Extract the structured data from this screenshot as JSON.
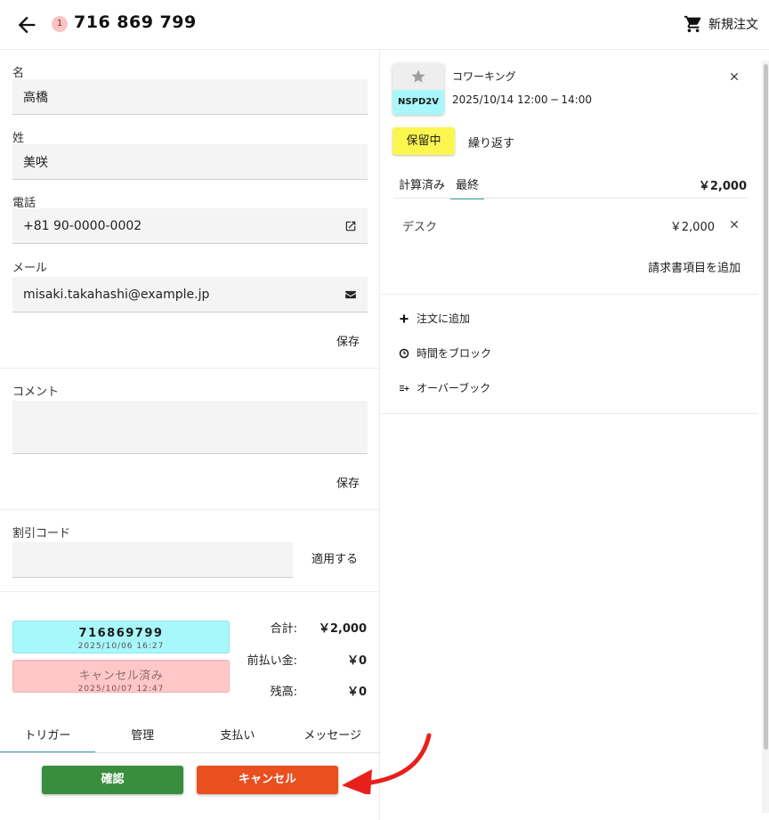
{
  "header": {
    "badge_count": "1",
    "order_number": "716 869 799",
    "new_order_label": "新規注文"
  },
  "form": {
    "first_name_label": "名",
    "first_name_value": "高橋",
    "last_name_label": "姓",
    "last_name_value": "美咲",
    "phone_label": "電話",
    "phone_value": "+81 90-0000-0002",
    "email_label": "メール",
    "email_value": "misaki.takahashi@example.jp",
    "save_label": "保存",
    "comment_label": "コメント",
    "comment_value": "",
    "comment_save_label": "保存",
    "discount_label": "割引コード",
    "discount_value": "",
    "apply_label": "適用する"
  },
  "codes": [
    {
      "code": "716869799",
      "date": "2025/10/06 16:27"
    },
    {
      "code": "キャンセル済み",
      "date": "2025/10/07 12:47"
    }
  ],
  "summary": {
    "total_label": "合計:",
    "total_value": "￥2,000",
    "prepaid_label": "前払い金:",
    "prepaid_value": "￥0",
    "balance_label": "残高:",
    "balance_value": "￥0"
  },
  "tabs": [
    "トリガー",
    "管理",
    "支払い",
    "メッセージ"
  ],
  "buttons": {
    "confirm": "確認",
    "cancel": "キャンセル"
  },
  "booking": {
    "thumb_code": "NSPD2V",
    "service_name": "コワーキング",
    "time_range": "2025/10/14 12:00 ─ 14:00",
    "status_label": "保留中",
    "repeat_label": "繰り返す",
    "price_tabs": [
      "計算済み",
      "最終"
    ],
    "price_total": "￥2,000",
    "item_name": "デスク",
    "item_price": "￥2,000",
    "add_invoice_label": "請求書項目を追加"
  },
  "actions": [
    {
      "label": "注文に追加",
      "icon": "plus-icon"
    },
    {
      "label": "時間をブロック",
      "icon": "clock-icon"
    },
    {
      "label": "オーバーブック",
      "icon": "overbook-icon"
    }
  ],
  "colors": {
    "code_chip": "#a8f7fb",
    "cancelled_chip": "#ffc7c8",
    "confirm": "#388e3c",
    "cancel": "#e94f1f",
    "hold": "#fbf550",
    "tab_accent": "#3aa0a6",
    "annotation_arrow": "#e8201c"
  }
}
